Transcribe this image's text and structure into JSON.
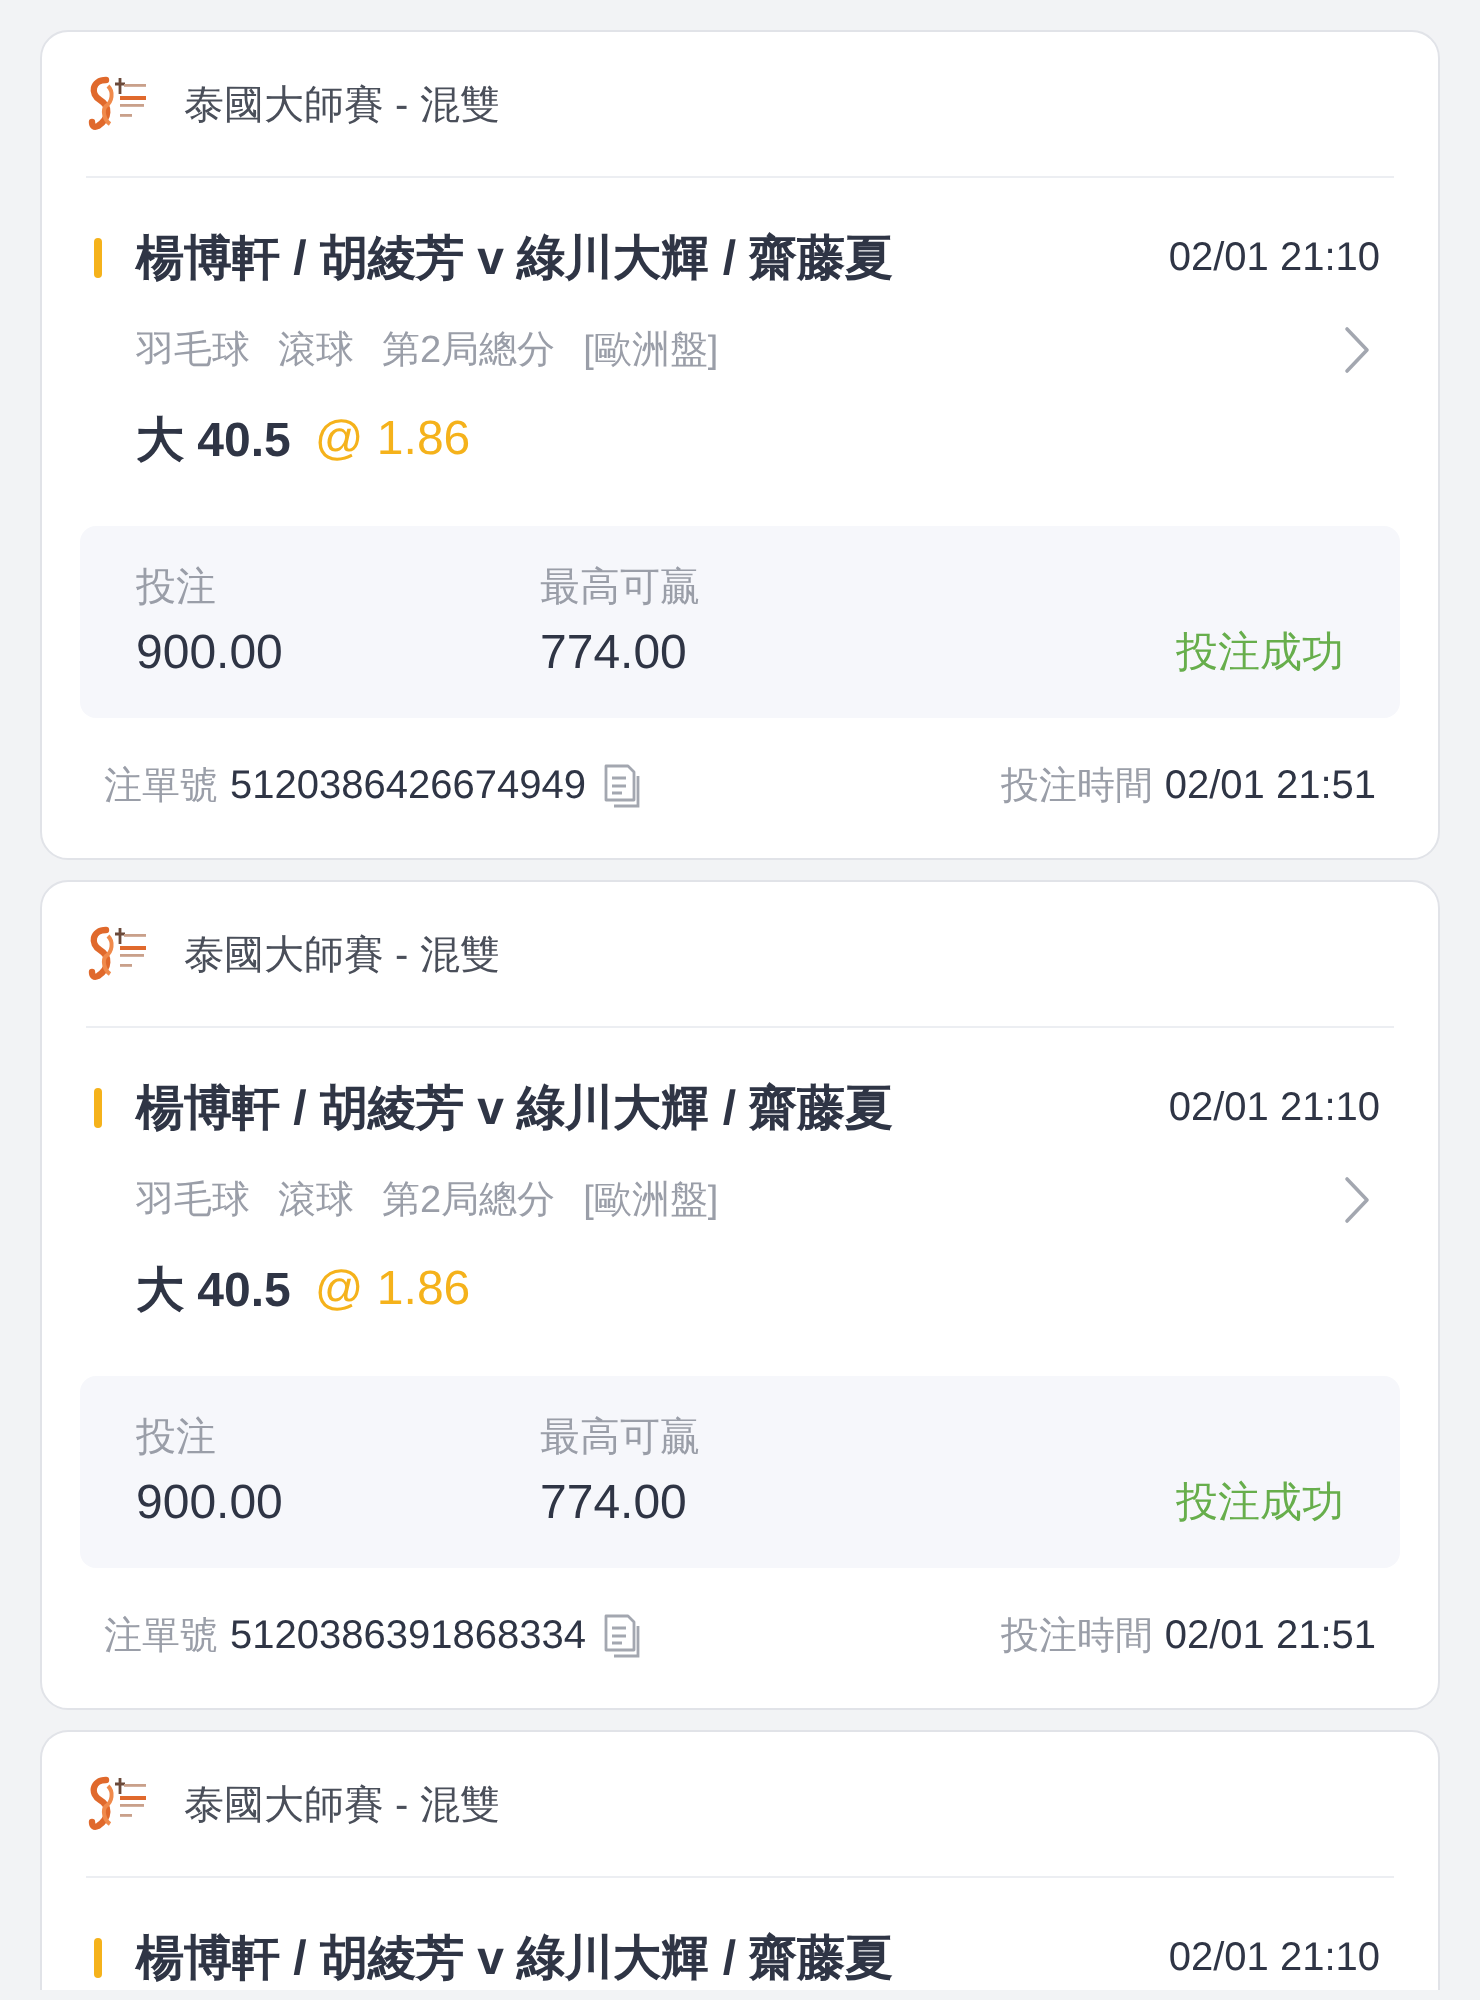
{
  "bets": [
    {
      "league": "泰國大師賽 - 混雙",
      "match": "楊博軒 / 胡綾芳 v 綠川大輝 / 齋藤夏",
      "start_time": "02/01 21:10",
      "tags": [
        "羽毛球",
        "滾球",
        "第2局總分",
        "[歐洲盤]"
      ],
      "selection": "大 40.5",
      "odds": "@ 1.86",
      "stake_label": "投注",
      "stake": "900.00",
      "max_win_label": "最高可贏",
      "max_win": "774.00",
      "status": "投注成功",
      "ticket_label": "注單號",
      "ticket_no": "5120386426674949",
      "time_label": "投注時間",
      "bet_time": "02/01 21:51"
    },
    {
      "league": "泰國大師賽 - 混雙",
      "match": "楊博軒 / 胡綾芳 v 綠川大輝 / 齋藤夏",
      "start_time": "02/01 21:10",
      "tags": [
        "羽毛球",
        "滾球",
        "第2局總分",
        "[歐洲盤]"
      ],
      "selection": "大 40.5",
      "odds": "@ 1.86",
      "stake_label": "投注",
      "stake": "900.00",
      "max_win_label": "最高可贏",
      "max_win": "774.00",
      "status": "投注成功",
      "ticket_label": "注單號",
      "ticket_no": "5120386391868334",
      "time_label": "投注時間",
      "bet_time": "02/01 21:51"
    },
    {
      "league": "泰國大師賽 - 混雙",
      "match": "楊博軒 / 胡綾芳 v 綠川大輝 / 齋藤夏",
      "start_time": "02/01 21:10"
    }
  ]
}
